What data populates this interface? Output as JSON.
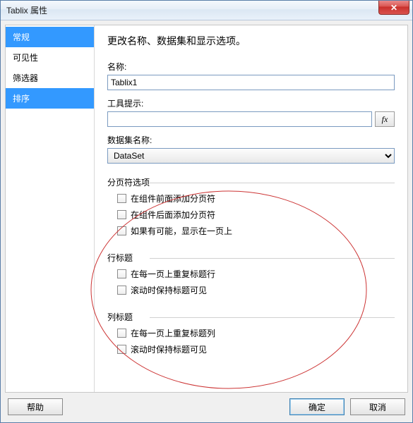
{
  "window": {
    "title": "Tablix 属性",
    "close_glyph": "✕"
  },
  "sidebar": {
    "items": [
      {
        "label": "常规",
        "selected": true
      },
      {
        "label": "可见性",
        "selected": false
      },
      {
        "label": "筛选器",
        "selected": false
      },
      {
        "label": "排序",
        "selected": true
      }
    ]
  },
  "main": {
    "heading": "更改名称、数据集和显示选项。",
    "name_label": "名称:",
    "name_value": "Tablix1",
    "tooltip_label": "工具提示:",
    "tooltip_value": "",
    "fx_label": "fx",
    "dataset_label": "数据集名称:",
    "dataset_value": "DataSet",
    "group_page": {
      "title": "分页符选项",
      "cb1": "在组件前面添加分页符",
      "cb2": "在组件后面添加分页符",
      "cb3": "如果有可能，显示在一页上"
    },
    "group_rowh": {
      "title": "行标题",
      "cb1": "在每一页上重复标题行",
      "cb2": "滚动时保持标题可见"
    },
    "group_colh": {
      "title": "列标题",
      "cb1": "在每一页上重复标题列",
      "cb2": "滚动时保持标题可见"
    }
  },
  "footer": {
    "help": "帮助",
    "ok": "确定",
    "cancel": "取消"
  }
}
